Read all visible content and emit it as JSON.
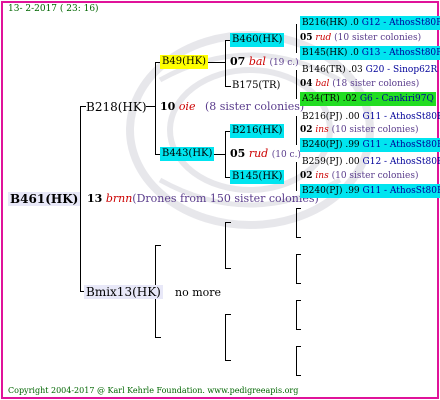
{
  "header": {
    "date": "13-  2-2017  ( 23: 16)"
  },
  "gen0": {
    "id": "B461(HK)",
    "year": "13",
    "breed": "brnn",
    "drones": "(Drones from 150 sister colonies)"
  },
  "gen1": {
    "mother": {
      "id": "B218(HK)",
      "year": "10",
      "breed": "oie",
      "sisters": "(8 sister colonies)"
    },
    "father": {
      "id": "Bmix13(HK)",
      "note": "no more"
    }
  },
  "gen2": {
    "mm": {
      "id": "B49(HK)"
    },
    "mf": {
      "id": "B443(HK)"
    }
  },
  "gen3": {
    "a": {
      "id": "B460(HK)"
    },
    "mid1": {
      "year": "07",
      "breed": "bal",
      "count": "(19 c.)"
    },
    "b": {
      "id": "B175(TR)"
    },
    "c": {
      "id": "B216(HK)"
    },
    "mid2": {
      "year": "05",
      "breed": "rud",
      "count": "(10 c.)"
    },
    "d": {
      "id": "B145(HK)"
    }
  },
  "gen4": {
    "r1": {
      "id": "B216(HK) .0",
      "loc": "G12 - AthosSt80R"
    },
    "r2": {
      "year": "05",
      "breed": "rud",
      "count": "(10 sister colonies)"
    },
    "r3": {
      "id": "B145(HK) .0",
      "loc": "G13 - AthosSt80R"
    },
    "r4": {
      "id": "B146(TR) .03",
      "loc": "G20 - Sinop62R"
    },
    "r5": {
      "year": "04",
      "breed": "bal",
      "count": "(18 sister colonies)"
    },
    "r6": {
      "id": "A34(TR) .02",
      "loc": "G6 - Cankiri97Q"
    },
    "r7": {
      "id": "B216(PJ) .00",
      "loc": "G11 - AthosSt80R"
    },
    "r8": {
      "year": "02",
      "breed": "ins",
      "count": "(10 sister colonies)"
    },
    "r9": {
      "id": "B240(PJ) .99",
      "loc": "G11 - AthosSt80R"
    },
    "r10": {
      "id": "B259(PJ) .00",
      "loc": "G12 - AthosSt80R"
    },
    "r11": {
      "year": "02",
      "breed": "ins",
      "count": "(10 sister colonies)"
    },
    "r12": {
      "id": "B240(PJ) .99",
      "loc": "G11 - AthosSt80R"
    }
  },
  "footer": {
    "copyright": "Copyright 2004-2017 @ Karl Kehrle Foundation.   www.pedigreeapis.org"
  }
}
